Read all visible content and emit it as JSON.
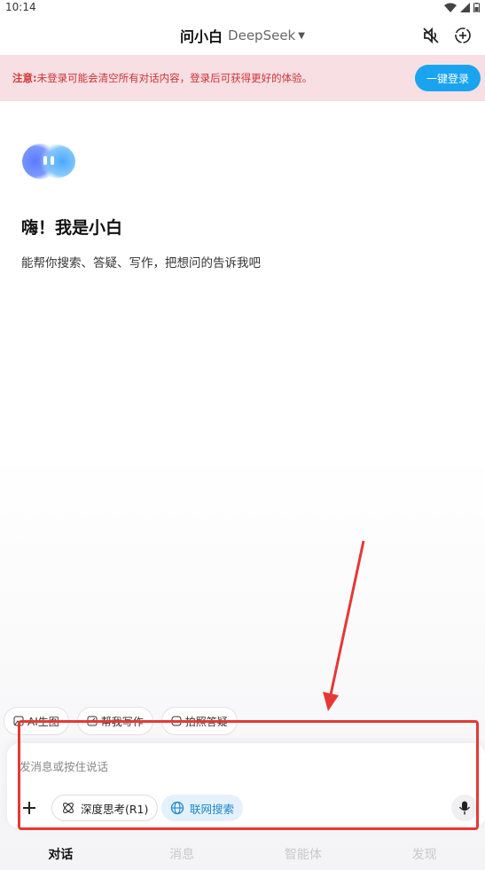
{
  "status_bar": {
    "time": "10:14"
  },
  "header": {
    "title": "问小白",
    "model": "DeepSeek",
    "icons": [
      "mute-icon",
      "new-chat-icon"
    ]
  },
  "notice": {
    "label": "注意:",
    "text": "未登录可能会清空所有对话内容，登录后可获得更好的体验。",
    "login_button": "一键登录"
  },
  "welcome": {
    "greeting": "嗨！我是小白",
    "subtitle": "能帮你搜索、答疑、写作，把想问的告诉我吧"
  },
  "quick_chips": [
    {
      "label": "AI生图",
      "icon": "image-icon"
    },
    {
      "label": "帮我写作",
      "icon": "pen-icon"
    },
    {
      "label": "拍照答疑",
      "icon": "camera-icon"
    }
  ],
  "composer": {
    "placeholder": "发消息或按住说话",
    "deep_think": "深度思考(R1)",
    "web_search": "联网搜索"
  },
  "tabs": [
    {
      "label": "对话",
      "active": true
    },
    {
      "label": "消息",
      "active": false
    },
    {
      "label": "智能体",
      "active": false
    },
    {
      "label": "发现",
      "active": false
    }
  ],
  "colors": {
    "accent": "#1aa4f0",
    "notice_bg": "#f7dfe3",
    "notice_text": "#d23a3a",
    "highlight": "#e53935"
  }
}
